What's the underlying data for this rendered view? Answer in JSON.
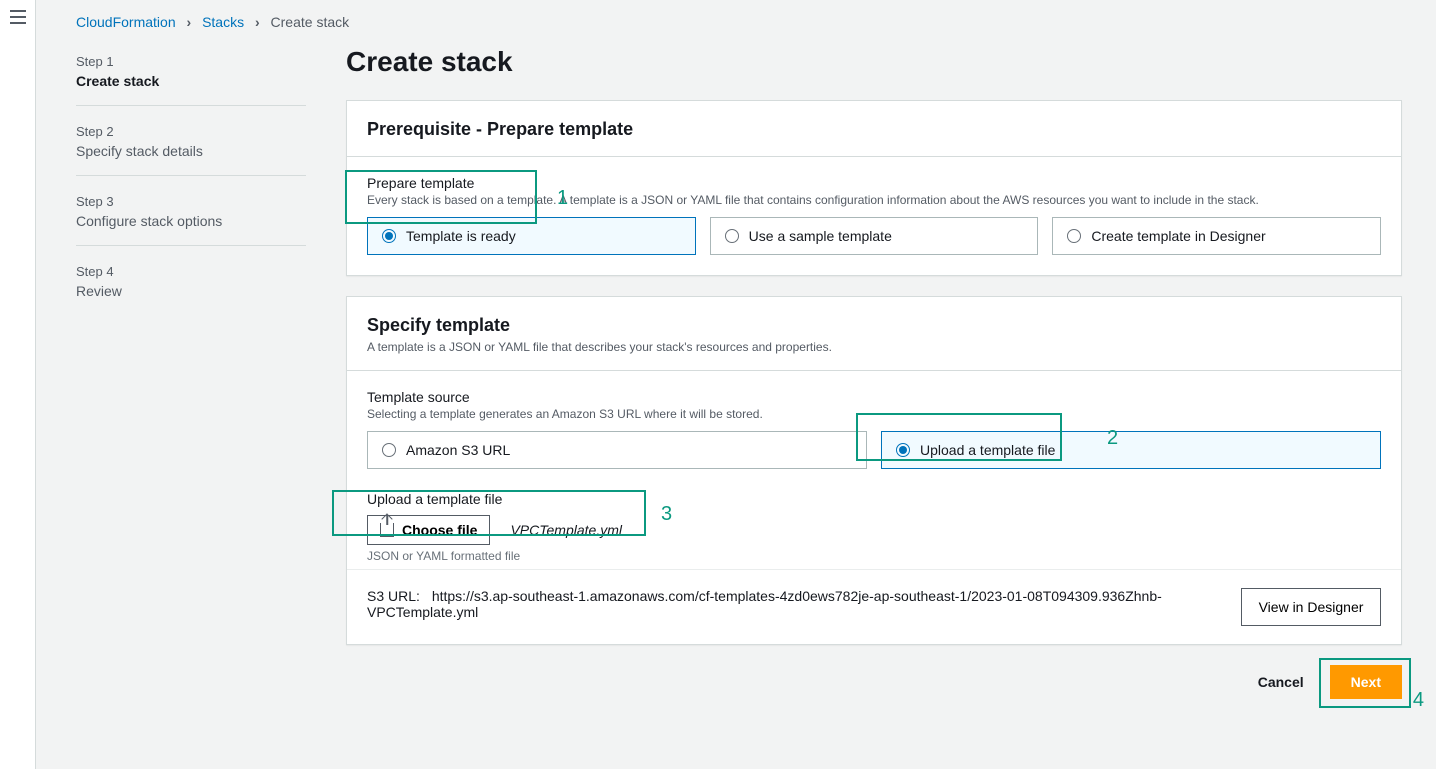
{
  "breadcrumb": {
    "root": "CloudFormation",
    "stacks": "Stacks",
    "current": "Create stack"
  },
  "wizard": {
    "steps": [
      {
        "num": "Step 1",
        "title": "Create stack"
      },
      {
        "num": "Step 2",
        "title": "Specify stack details"
      },
      {
        "num": "Step 3",
        "title": "Configure stack options"
      },
      {
        "num": "Step 4",
        "title": "Review"
      }
    ]
  },
  "page_title": "Create stack",
  "panel1": {
    "title": "Prerequisite - Prepare template",
    "field_label": "Prepare template",
    "field_desc": "Every stack is based on a template. A template is a JSON or YAML file that contains configuration information about the AWS resources you want to include in the stack.",
    "options": {
      "ready": "Template is ready",
      "sample": "Use a sample template",
      "designer": "Create template in Designer"
    }
  },
  "panel2": {
    "title": "Specify template",
    "desc": "A template is a JSON or YAML file that describes your stack's resources and properties.",
    "source_label": "Template source",
    "source_desc": "Selecting a template generates an Amazon S3 URL where it will be stored.",
    "source_options": {
      "s3": "Amazon S3 URL",
      "upload": "Upload a template file"
    },
    "upload_label": "Upload a template file",
    "choose_label": "Choose file",
    "chosen_file": "VPCTemplate.yml",
    "file_hint": "JSON or YAML formatted file",
    "s3_label": "S3 URL:",
    "s3_value": "https://s3.ap-southeast-1.amazonaws.com/cf-templates-4zd0ews782je-ap-southeast-1/2023-01-08T094309.936Zhnb-VPCTemplate.yml",
    "view_designer": "View in Designer"
  },
  "footer": {
    "cancel": "Cancel",
    "next": "Next"
  },
  "annotations": {
    "n1": "1",
    "n2": "2",
    "n3": "3",
    "n4": "4"
  }
}
